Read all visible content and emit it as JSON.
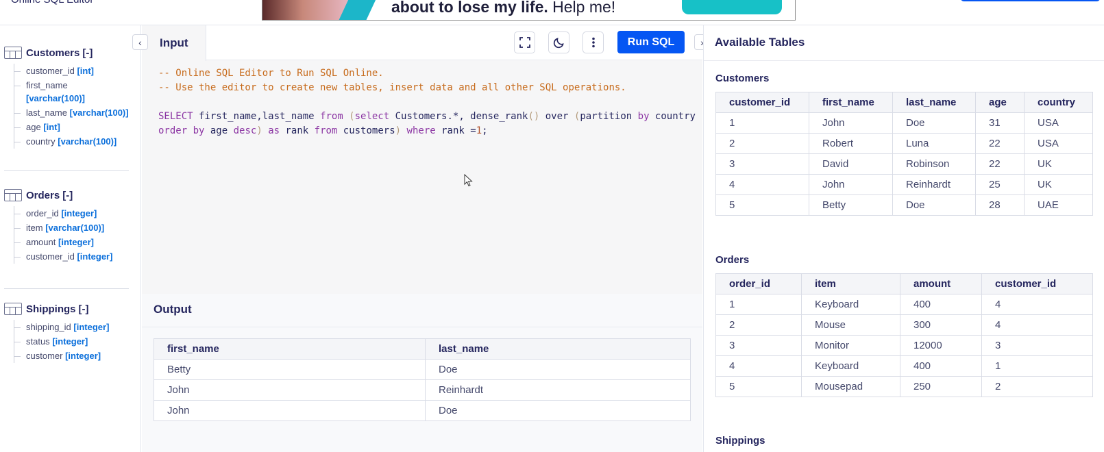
{
  "header": {
    "app_title": "Online SQL Editor",
    "ad_text_bold": "about to lose my life.",
    "ad_text_regular": " Help me!"
  },
  "sidebar": {
    "schemas": [
      {
        "name": "Customers",
        "toggle": "[-]",
        "columns": [
          {
            "name": "customer_id",
            "type": "[int]"
          },
          {
            "name": "first_name",
            "type": "[varchar(100)]"
          },
          {
            "name": "last_name",
            "type": "[varchar(100)]"
          },
          {
            "name": "age",
            "type": "[int]"
          },
          {
            "name": "country",
            "type": "[varchar(100)]"
          }
        ]
      },
      {
        "name": "Orders",
        "toggle": "[-]",
        "columns": [
          {
            "name": "order_id",
            "type": "[integer]"
          },
          {
            "name": "item",
            "type": "[varchar(100)]"
          },
          {
            "name": "amount",
            "type": "[integer]"
          },
          {
            "name": "customer_id",
            "type": "[integer]"
          }
        ]
      },
      {
        "name": "Shippings",
        "toggle": "[-]",
        "columns": [
          {
            "name": "shipping_id",
            "type": "[integer]"
          },
          {
            "name": "status",
            "type": "[integer]"
          },
          {
            "name": "customer",
            "type": "[integer]"
          }
        ]
      }
    ]
  },
  "editor": {
    "tab_label": "Input",
    "run_label": "Run SQL",
    "collapse_left_glyph": "‹",
    "collapse_right_glyph": "›",
    "code": {
      "comment1": "-- Online SQL Editor to Run SQL Online.",
      "comment2": "-- Use the editor to create new tables, insert data and all other SQL operations.",
      "line3_select": "SELECT",
      "line3_a": " first_name,last_name ",
      "line3_from": "from",
      "line3_p1": " (",
      "line3_select2": "select",
      "line3_b": " Customers.*, dense_rank",
      "line3_p2": "()",
      "line3_c": " over ",
      "line3_p3": "(",
      "line3_d": "partition ",
      "line3_by": "by",
      "line3_e": " country",
      "line4_order": "order",
      "line4_a": " ",
      "line4_by": "by",
      "line4_b": " age ",
      "line4_desc": "desc",
      "line4_p": ")",
      "line4_c": " ",
      "line4_as": "as",
      "line4_d": " rank ",
      "line4_from": "from",
      "line4_e": " customers",
      "line4_p2": ")",
      "line4_f": " ",
      "line4_where": "where",
      "line4_g": " rank =",
      "line4_num": "1",
      "line4_h": ";"
    }
  },
  "output": {
    "title": "Output",
    "headers": [
      "first_name",
      "last_name"
    ],
    "rows": [
      [
        "Betty",
        "Doe"
      ],
      [
        "John",
        "Reinhardt"
      ],
      [
        "John",
        "Doe"
      ]
    ]
  },
  "available": {
    "title": "Available Tables",
    "customers": {
      "label": "Customers",
      "headers": [
        "customer_id",
        "first_name",
        "last_name",
        "age",
        "country"
      ],
      "rows": [
        [
          "1",
          "John",
          "Doe",
          "31",
          "USA"
        ],
        [
          "2",
          "Robert",
          "Luna",
          "22",
          "USA"
        ],
        [
          "3",
          "David",
          "Robinson",
          "22",
          "UK"
        ],
        [
          "4",
          "John",
          "Reinhardt",
          "25",
          "UK"
        ],
        [
          "5",
          "Betty",
          "Doe",
          "28",
          "UAE"
        ]
      ]
    },
    "orders": {
      "label": "Orders",
      "headers": [
        "order_id",
        "item",
        "amount",
        "customer_id"
      ],
      "rows": [
        [
          "1",
          "Keyboard",
          "400",
          "4"
        ],
        [
          "2",
          "Mouse",
          "300",
          "4"
        ],
        [
          "3",
          "Monitor",
          "12000",
          "3"
        ],
        [
          "4",
          "Keyboard",
          "400",
          "1"
        ],
        [
          "5",
          "Mousepad",
          "250",
          "2"
        ]
      ]
    },
    "shippings": {
      "label": "Shippings"
    }
  },
  "colors": {
    "accent": "#0556f3",
    "type_blue": "#0b6fdb",
    "comment_orange": "#c76b1c",
    "keyword_purple": "#8b35a3"
  }
}
